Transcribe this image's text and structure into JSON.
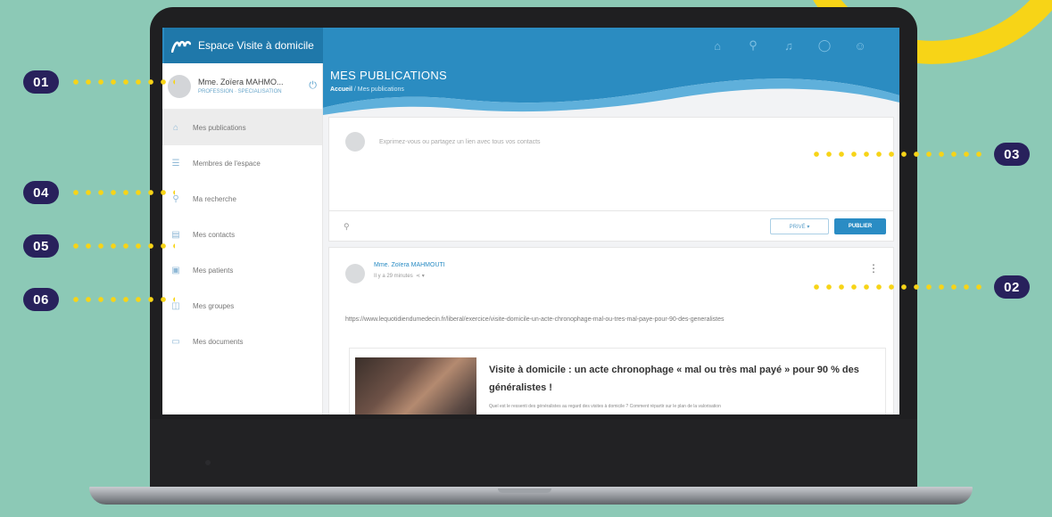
{
  "app": {
    "title": "Espace Visite à domicile"
  },
  "topbar_icons": [
    "home-icon",
    "search-icon",
    "bell-icon",
    "chat-icon",
    "users-icon"
  ],
  "profile": {
    "name": "Mme. Zoïera MAHMO...",
    "role": "PROFESSION · SPECIALISATION"
  },
  "sidebar": {
    "items": [
      {
        "label": "Mes publications",
        "icon": "home-icon",
        "active": true
      },
      {
        "label": "Membres de l'espace",
        "icon": "list-icon",
        "active": false
      },
      {
        "label": "Ma recherche",
        "icon": "search-icon",
        "active": false
      },
      {
        "label": "Mes contacts",
        "icon": "contacts-icon",
        "active": false
      },
      {
        "label": "Mes patients",
        "icon": "patients-icon",
        "active": false
      },
      {
        "label": "Mes groupes",
        "icon": "groups-icon",
        "active": false
      },
      {
        "label": "Mes documents",
        "icon": "documents-icon",
        "active": false
      }
    ]
  },
  "page": {
    "title": "MES PUBLICATIONS",
    "breadcrumb_home": "Accueil",
    "breadcrumb_current": " / Mes publications"
  },
  "composer": {
    "placeholder": "Exprimez-vous ou partagez un lien avec tous vos contacts",
    "privacy_label": "PRIVÉ ▾",
    "publish_label": "PUBLIER"
  },
  "post": {
    "author": "Mme. Zoïera MAHMOUTI",
    "time": "Il y a 29 minutes",
    "link": "https://www.lequotidiendumedecin.fr/liberal/exercice/visite-domicile-un-acte-chronophage-mal-ou-tres-mal-paye-pour-90-des-generalistes",
    "preview_title": "Visite à domicile : un acte chronophage « mal ou très mal payé » pour 90 % des généralistes !",
    "preview_desc": "Quel est le ressenti des généralistes au regard des visites à domicile ? Comment répartir sur le plan de la valorisation"
  },
  "callouts": [
    {
      "label": "01"
    },
    {
      "label": "02"
    },
    {
      "label": "03"
    },
    {
      "label": "04"
    },
    {
      "label": "05"
    },
    {
      "label": "06"
    }
  ],
  "colors": {
    "background": "#8cc9b6",
    "primary_blue": "#2b8cc1",
    "badge_navy": "#28215c",
    "dot_yellow": "#f7d417"
  }
}
